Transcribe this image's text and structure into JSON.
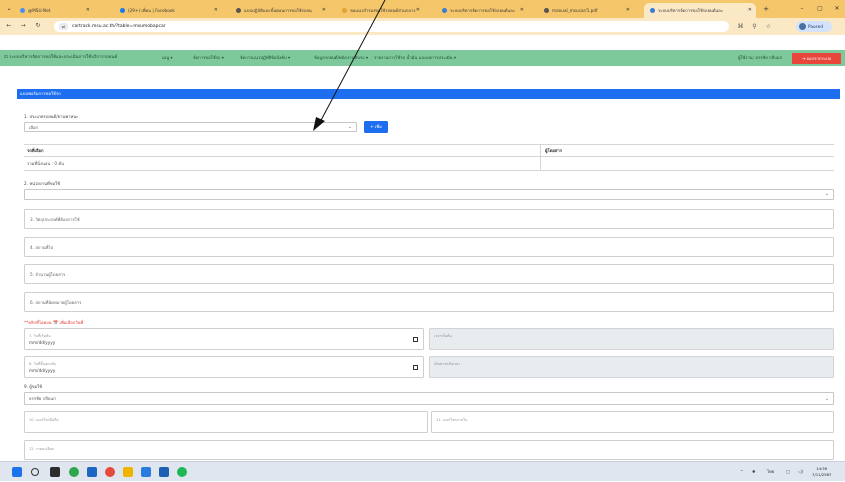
{
  "browser": {
    "tabs": [
      {
        "label": "@MSU-Net",
        "color": "#4a8df0"
      },
      {
        "label": "(29+) เพื่อน | Facebook",
        "color": "#1877f2"
      },
      {
        "label": "แบบปฏิบัติและขั้นตอนการขอใช้รถยน",
        "color": "#555"
      },
      {
        "label": "ขอแนวสำรองขอใช้รถยนต์ส่วนกลาง",
        "color": "#e0a430"
      },
      {
        "label": "ระบบบริหารจัดการขอใช้รถยนต์และ",
        "color": "#3a7bd5"
      },
      {
        "label": "manual_msucar/1.pdf",
        "color": "#555"
      },
      {
        "label": "ระบบบริหารจัดการขอใช้รถยนต์และ",
        "color": "#3a7bd5"
      }
    ],
    "url": "cartrack.msu.ac.th/?table=msumobapcar",
    "profile_label": "Paused"
  },
  "appnav": {
    "brand": "ระบบบริหารจัดการขอใช้และประเมินการใช้บริการรถยนต์",
    "menus": [
      "เมนู ▾",
      "จัดการขอใช้รถ ▾",
      "จัดการแนวปฏิบัติข้อบังคับ ▾",
      "ข้อมูลรถยนต์/พนักงานขับรถ ▾",
      "รายงานการใช้รถ น้ำมัน และผลการประเมิน ▾"
    ],
    "user": "ผู้ใช้งาน: ธรรชัย กลีบแก่",
    "logout": "ออกจากระบบ"
  },
  "form": {
    "header": "แบบฟอร์มการขอใช้รถ",
    "type_label": "1. ประเภทรถยนต์/ยานพาหนะ",
    "type_value": "เลือก",
    "add_button": "+ เพิ่ม",
    "table_col1": "รถที่เลือก",
    "table_col2": "ผู้โดยสาร",
    "total_seats": "รวมที่นั่งนอน : 0 คัน",
    "unit_label": "2. หน่วยงานที่ขอใช้",
    "purpose_placeholder": "3. วัตถุประสงค์ที่ต้องการใช้",
    "destination_placeholder": "4. สถานที่ไป",
    "passenger_count_placeholder": "5. จำนวนผู้โดยสาร",
    "pickup_place_placeholder": "6. สถานที่นัดหมายผู้โดยสาร",
    "calendar_notice": "**คลิกที่ไอคอน 📅 เพื่อเลือกวันที่",
    "start_date_label": "7. วันที่เริ่มต้น",
    "start_date_value": "mm/dd/yyyy",
    "start_time_label": "เวลาเริ่มต้น",
    "end_date_label": "8. วันที่สิ้นสุดกลับ",
    "end_date_value": "mm/dd/yyyy",
    "end_time_label": "เดินทางกลับเวลา",
    "requester_label": "9. ผู้ขอใช้",
    "requester_value": "ธรรชัย กลีบแก่",
    "phone_label": "10. เบอร์โทรมือถือ",
    "internal_phone_label": "11. เบอร์โทรภายใน",
    "note_label": "12. รายละเอียด"
  },
  "taskbar": {
    "lang": "ไทย",
    "time": "14:59",
    "date": "7/11/2567"
  }
}
